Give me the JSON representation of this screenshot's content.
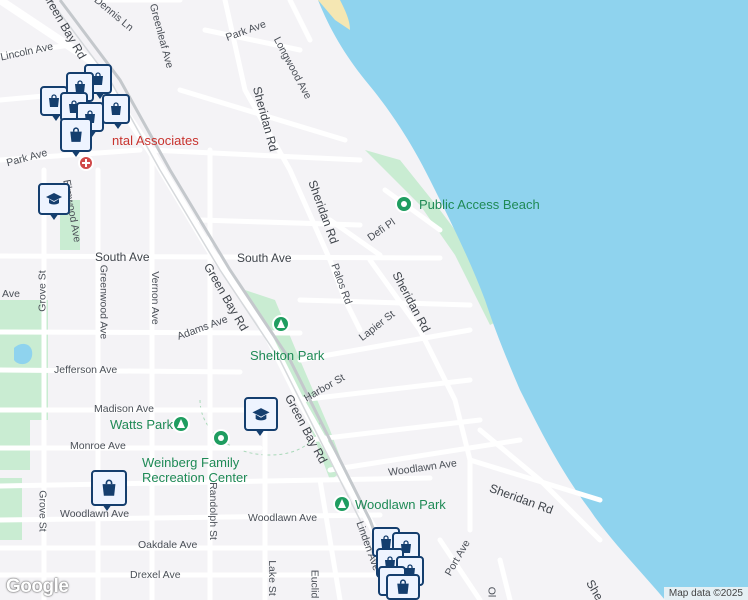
{
  "colors": {
    "water": "#8fd3ee",
    "land": "#f4f3f6",
    "park": "#c9ecd2",
    "road": "#ffffff",
    "rail": "#c4c8cc",
    "brand_pin": "#143e6e",
    "poi_green": "#1f9d60",
    "poi_red": "#c8332e"
  },
  "streets": {
    "dennis_ln": "Dennis Ln",
    "greenleaf_ave": "Greenleaf Ave",
    "park_ave_top": "Park Ave",
    "longwood_ave": "Longwood Ave",
    "green_bay_rd_top": "Green Bay Rd",
    "lincoln_ave": "Lincoln Ave",
    "sheridan_rd_1": "Sheridan Rd",
    "sheridan_rd_2": "Sheridan Rd",
    "sheridan_rd_3": "Sheridan Rd",
    "sheridan_rd_4": "Sheridan Rd",
    "sheridan_rd_5": "Sheridan Rd",
    "park_ave_left": "Park Ave",
    "elmwood_ave": "Elmwood Ave",
    "south_ave_left": "South Ave",
    "south_ave_right": "South Ave",
    "defi_pl": "Defi Pl",
    "palos_rd": "Palos Rd",
    "grove_st_top": "Grove St",
    "greenwood_ave": "Greenwood Ave",
    "vernon_ave": "Vernon Ave",
    "green_bay_rd_mid": "Green Bay Rd",
    "green_bay_rd_low": "Green Bay Rd",
    "adams_ave": "Adams Ave",
    "lapier_st": "Lapier St",
    "ave_left": "Ave",
    "jefferson_ave": "Jefferson Ave",
    "harbor_st": "Harbor St",
    "madison_ave": "Madison Ave",
    "monroe_ave": "Monroe Ave",
    "randolph_st": "Randolph St",
    "woodlawn_ave_right": "Woodlawn Ave",
    "woodlawn_ave_left": "Woodlawn Ave",
    "woodlawn_ave_mid": "Woodlawn Ave",
    "grove_st_low": "Grove St",
    "oakdale_ave": "Oakdale Ave",
    "linden_ave": "Linden Ave",
    "drexel_ave": "Drexel Ave",
    "lake_st": "Lake St",
    "euclid": "Euclid",
    "port_ave": "Port Ave",
    "she": "She",
    "ol": "Ol"
  },
  "places": {
    "public_access_beach": "Public Access Beach",
    "shelton_park": "Shelton Park",
    "watts_park": "Watts Park",
    "weinberg_line1": "Weinberg Family",
    "weinberg_line2": "Recreation Center",
    "woodlawn_park": "Woodlawn Park",
    "dental_associates": "ntal Associates"
  },
  "icons": {
    "shopping": "shopping-bag-icon",
    "school": "school-icon",
    "park": "tree-icon",
    "place": "place-icon",
    "hospital": "hospital-icon"
  },
  "footer": {
    "google": "Google",
    "map_data": "Map data ©2025"
  }
}
